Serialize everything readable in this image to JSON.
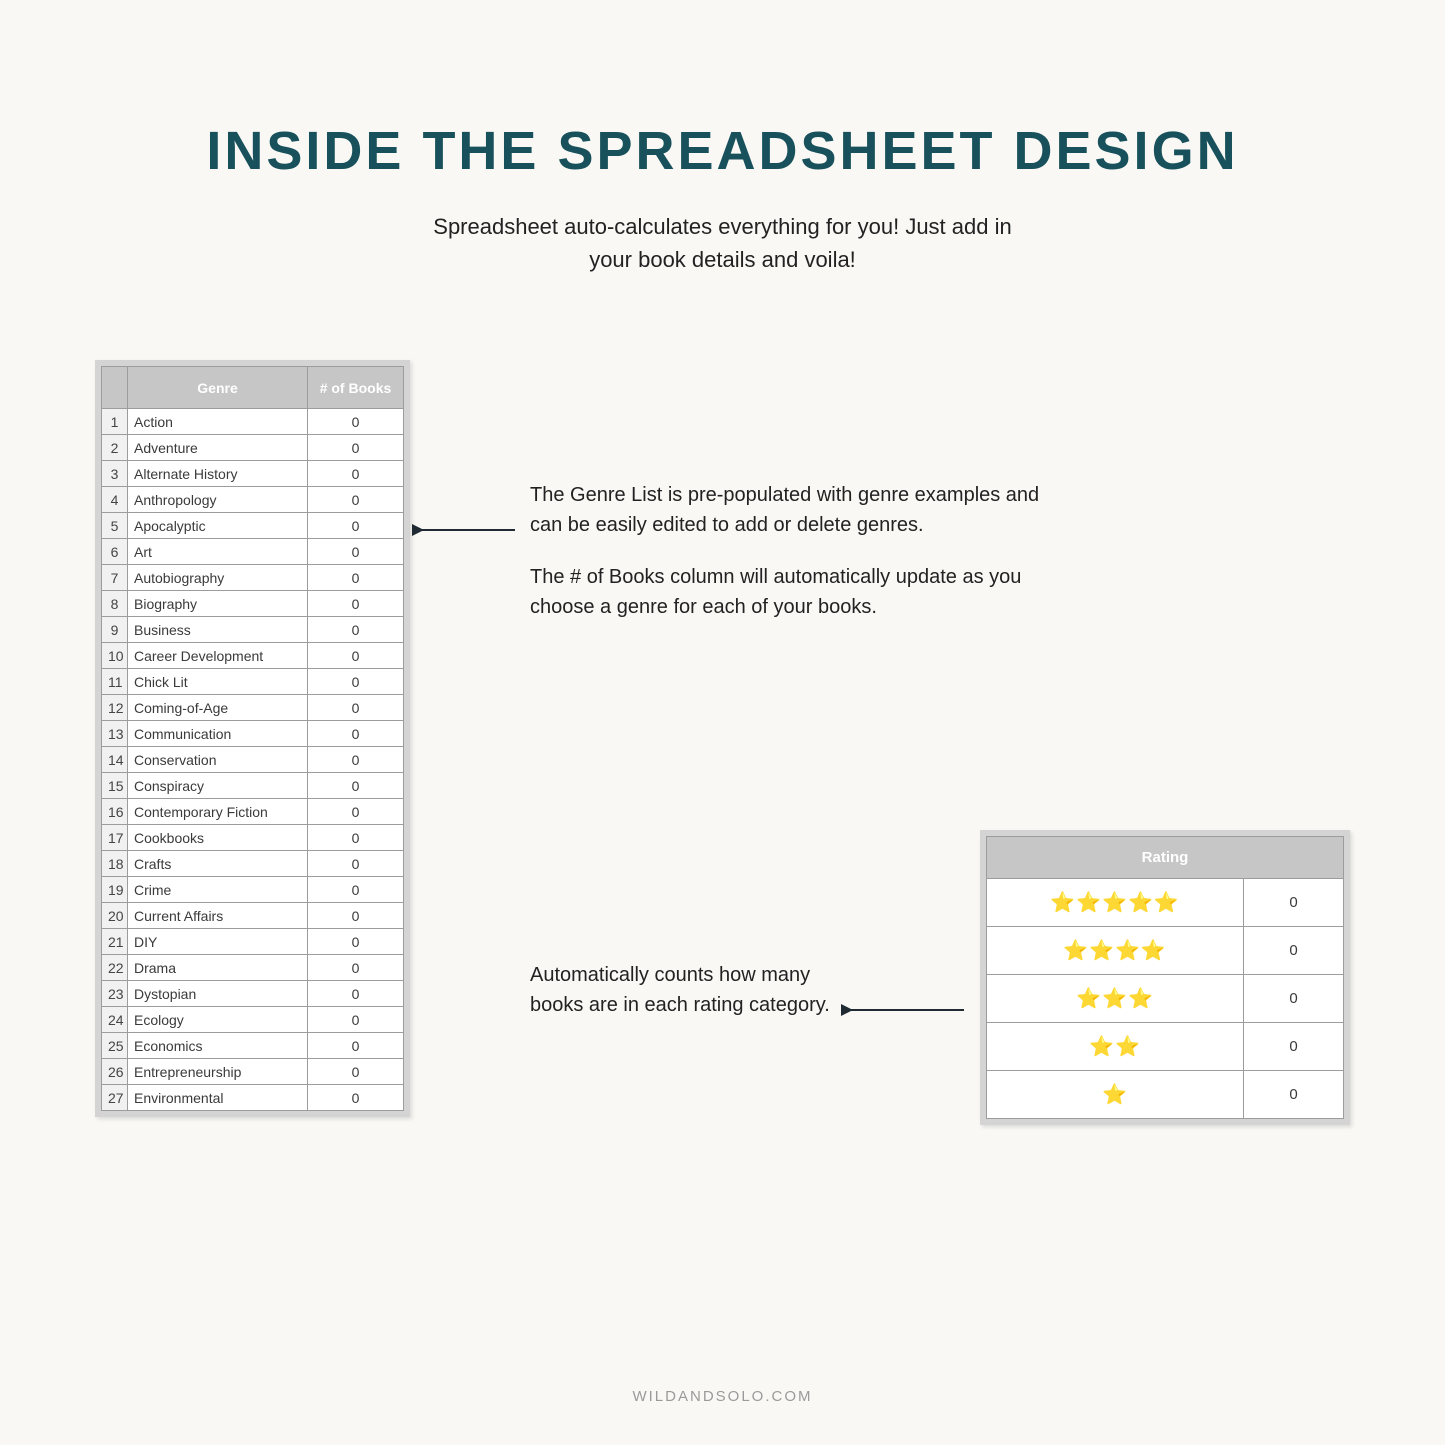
{
  "title": "INSIDE THE SPREADSHEET DESIGN",
  "subtitle": {
    "line1": "Spreadsheet auto-calculates everything for you! Just add in",
    "line2": "your book details and voila!"
  },
  "genre_table": {
    "headers": {
      "genre": "Genre",
      "count": "# of Books"
    },
    "rows": [
      {
        "n": "1",
        "name": "Action",
        "count": "0"
      },
      {
        "n": "2",
        "name": "Adventure",
        "count": "0"
      },
      {
        "n": "3",
        "name": "Alternate History",
        "count": "0"
      },
      {
        "n": "4",
        "name": "Anthropology",
        "count": "0"
      },
      {
        "n": "5",
        "name": "Apocalyptic",
        "count": "0"
      },
      {
        "n": "6",
        "name": "Art",
        "count": "0"
      },
      {
        "n": "7",
        "name": "Autobiography",
        "count": "0"
      },
      {
        "n": "8",
        "name": "Biography",
        "count": "0"
      },
      {
        "n": "9",
        "name": "Business",
        "count": "0"
      },
      {
        "n": "10",
        "name": "Career Development",
        "count": "0"
      },
      {
        "n": "11",
        "name": "Chick Lit",
        "count": "0"
      },
      {
        "n": "12",
        "name": "Coming-of-Age",
        "count": "0"
      },
      {
        "n": "13",
        "name": "Communication",
        "count": "0"
      },
      {
        "n": "14",
        "name": "Conservation",
        "count": "0"
      },
      {
        "n": "15",
        "name": "Conspiracy",
        "count": "0"
      },
      {
        "n": "16",
        "name": "Contemporary Fiction",
        "count": "0"
      },
      {
        "n": "17",
        "name": "Cookbooks",
        "count": "0"
      },
      {
        "n": "18",
        "name": "Crafts",
        "count": "0"
      },
      {
        "n": "19",
        "name": "Crime",
        "count": "0"
      },
      {
        "n": "20",
        "name": "Current Affairs",
        "count": "0"
      },
      {
        "n": "21",
        "name": "DIY",
        "count": "0"
      },
      {
        "n": "22",
        "name": "Drama",
        "count": "0"
      },
      {
        "n": "23",
        "name": "Dystopian",
        "count": "0"
      },
      {
        "n": "24",
        "name": "Ecology",
        "count": "0"
      },
      {
        "n": "25",
        "name": "Economics",
        "count": "0"
      },
      {
        "n": "26",
        "name": "Entrepreneurship",
        "count": "0"
      },
      {
        "n": "27",
        "name": "Environmental",
        "count": "0"
      }
    ]
  },
  "callout1": {
    "p1": "The Genre List is pre-populated with genre examples and can be easily edited to add or delete genres.",
    "p2": "The # of Books column will automatically update as you choose a genre for each of your books."
  },
  "callout2": {
    "text": "Automatically counts how many books are in each rating category."
  },
  "rating_table": {
    "header": "Rating",
    "rows": [
      {
        "stars": "⭐⭐⭐⭐⭐",
        "count": "0"
      },
      {
        "stars": "⭐⭐⭐⭐",
        "count": "0"
      },
      {
        "stars": "⭐⭐⭐",
        "count": "0"
      },
      {
        "stars": "⭐⭐",
        "count": "0"
      },
      {
        "stars": "⭐",
        "count": "0"
      }
    ]
  },
  "footer": "WILDANDSOLO.COM"
}
